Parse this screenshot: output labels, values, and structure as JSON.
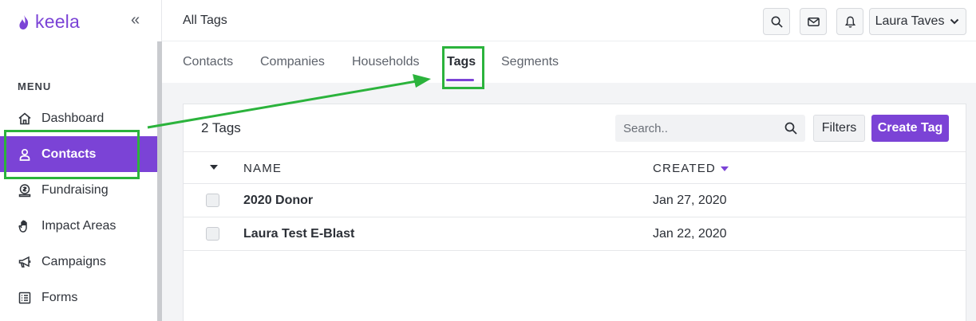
{
  "app": {
    "logo_text": "keela",
    "brand_color": "#7b43d6"
  },
  "header": {
    "title": "All Tags",
    "user_name": "Laura Taves",
    "icons": [
      "search-icon",
      "mail-icon",
      "bell-icon"
    ]
  },
  "sidebar": {
    "menu_label": "MENU",
    "items": [
      {
        "label": "Dashboard",
        "icon": "home-icon"
      },
      {
        "label": "Contacts",
        "icon": "user-icon",
        "active": true
      },
      {
        "label": "Fundraising",
        "icon": "money-icon"
      },
      {
        "label": "Impact Areas",
        "icon": "hand-icon"
      },
      {
        "label": "Campaigns",
        "icon": "megaphone-icon"
      },
      {
        "label": "Forms",
        "icon": "list-icon"
      }
    ]
  },
  "tabs": [
    {
      "label": "Contacts"
    },
    {
      "label": "Companies"
    },
    {
      "label": "Households"
    },
    {
      "label": "Tags",
      "active": true
    },
    {
      "label": "Segments"
    }
  ],
  "card": {
    "count": "2 Tags",
    "search_placeholder": "Search..",
    "filters_label": "Filters",
    "create_label": "Create Tag",
    "columns": {
      "name": "NAME",
      "created": "CREATED"
    },
    "rows": [
      {
        "name": "2020 Donor",
        "created": "Jan 27, 2020"
      },
      {
        "name": "Laura Test E-Blast",
        "created": "Jan 22, 2020"
      }
    ]
  },
  "annotation": {
    "color": "#2bb33c"
  }
}
